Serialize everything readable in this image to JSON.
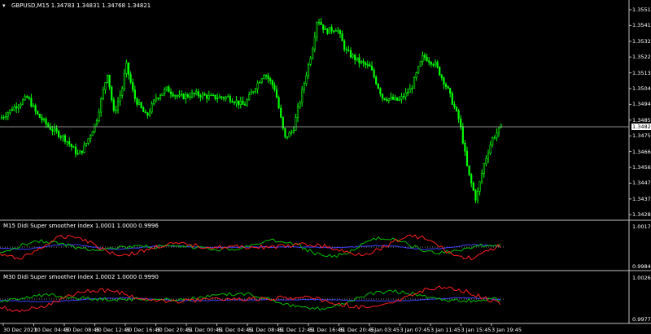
{
  "main": {
    "title": "GBPUSD,M15  1.34783 1.34831 1.34768 1.34821",
    "current_price": "1.34821",
    "price_axis": [
      "1.35510",
      "1.35415",
      "1.35320",
      "1.35225",
      "1.35130",
      "1.35040",
      "1.34945",
      "1.34850",
      "1.34755",
      "1.34660",
      "1.34565",
      "1.34470",
      "1.34375",
      "1.34280"
    ],
    "colors": {
      "candle": "#00ff00",
      "price_line": "#c0c0c0",
      "frame": "#c0c0c0"
    }
  },
  "ind1": {
    "title": "M15 Didi Super smoother index 1.0001 1.0000 0.9996",
    "top_value": "1.0017",
    "bottom_value": "0.9984"
  },
  "ind2": {
    "title": "M30 Didi Super smoother index 1.0002 1.0000 0.9990",
    "top_value": "1.0026",
    "bottom_value": "0.9977"
  },
  "time_axis": [
    "30 Dec 2021",
    "30 Dec 04:45",
    "30 Dec 08:45",
    "30 Dec 12:45",
    "30 Dec 16:45",
    "30 Dec 20:45",
    "31 Dec 00:45",
    "31 Dec 04:45",
    "31 Dec 08:45",
    "31 Dec 12:45",
    "31 Dec 16:45",
    "31 Dec 20:45",
    "3 Jan 03:45",
    "3 Jan 07:45",
    "3 Jan 11:45",
    "3 Jan 15:45",
    "3 Jan 19:45"
  ],
  "chart_data": {
    "type": "line",
    "title": "GBPUSD,M15",
    "x": [
      0,
      4,
      8,
      12,
      16,
      20,
      24,
      28,
      32,
      36,
      40,
      44,
      48,
      52,
      56,
      60,
      64,
      68,
      72,
      76,
      80,
      84,
      88,
      92,
      96,
      100,
      104,
      108,
      112,
      116,
      120,
      124,
      128,
      132,
      136,
      140,
      144,
      148,
      152,
      156
    ],
    "series": [
      {
        "name": "close",
        "values": [
          1.3487,
          1.3492,
          1.3495,
          1.35,
          1.3493,
          1.3484,
          1.3478,
          1.3472,
          1.3467,
          1.3476,
          1.3488,
          1.351,
          1.3501,
          1.3515,
          1.3495,
          1.3488,
          1.3498,
          1.3505,
          1.35,
          1.3496,
          1.3502,
          1.3505,
          1.35,
          1.35,
          1.3505,
          1.3518,
          1.351,
          1.349,
          1.3475,
          1.3505,
          1.3525,
          1.3545,
          1.3542,
          1.3537,
          1.353,
          1.3525,
          1.3518,
          1.351,
          1.3498,
          1.35
        ]
      }
    ],
    "ylim": [
      1.3428,
      1.3556
    ]
  }
}
